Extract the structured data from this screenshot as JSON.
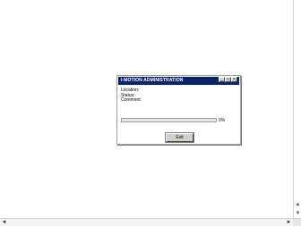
{
  "dialog": {
    "title": "I-MOTION ADMINISTRATION",
    "title_buttons": {
      "minimize": "_",
      "maximize": "□",
      "close": "×"
    },
    "fields": {
      "location_label": "Location:",
      "status_label": "Status:",
      "comment_label": "Comment:"
    },
    "progress": {
      "value": 0,
      "label": "0%"
    },
    "exit_label": "Exit"
  },
  "scrollbars": {
    "up": "▲",
    "down": "▼",
    "left": "◄",
    "right": "►"
  },
  "colors": {
    "titlebar": "#0a246a",
    "button_face": "#d4d0c8"
  }
}
